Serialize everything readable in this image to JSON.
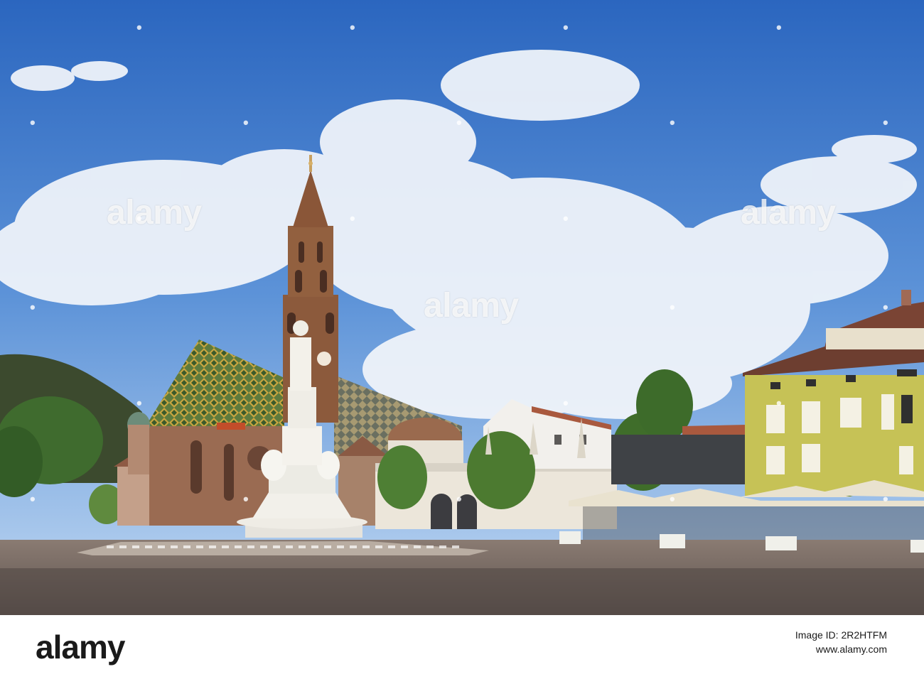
{
  "image": {
    "description_colors": {
      "sky_top": "#2f6fc4",
      "sky_bottom": "#8fb8e6",
      "cloud": "#f4f7fb",
      "pavement": "#7d6e66",
      "facade_yellow": "#c9c656",
      "roof_tile_green": "#4e6b3a",
      "stone_tower": "#8c5a3c",
      "statue_white": "#f2f0ea"
    }
  },
  "watermarks": {
    "main": "alamy",
    "left": "alamy",
    "right": "alamy"
  },
  "footer": {
    "brand": "alamy",
    "image_id": "Image ID: 2R2HTFM",
    "url": "www.alamy.com"
  }
}
